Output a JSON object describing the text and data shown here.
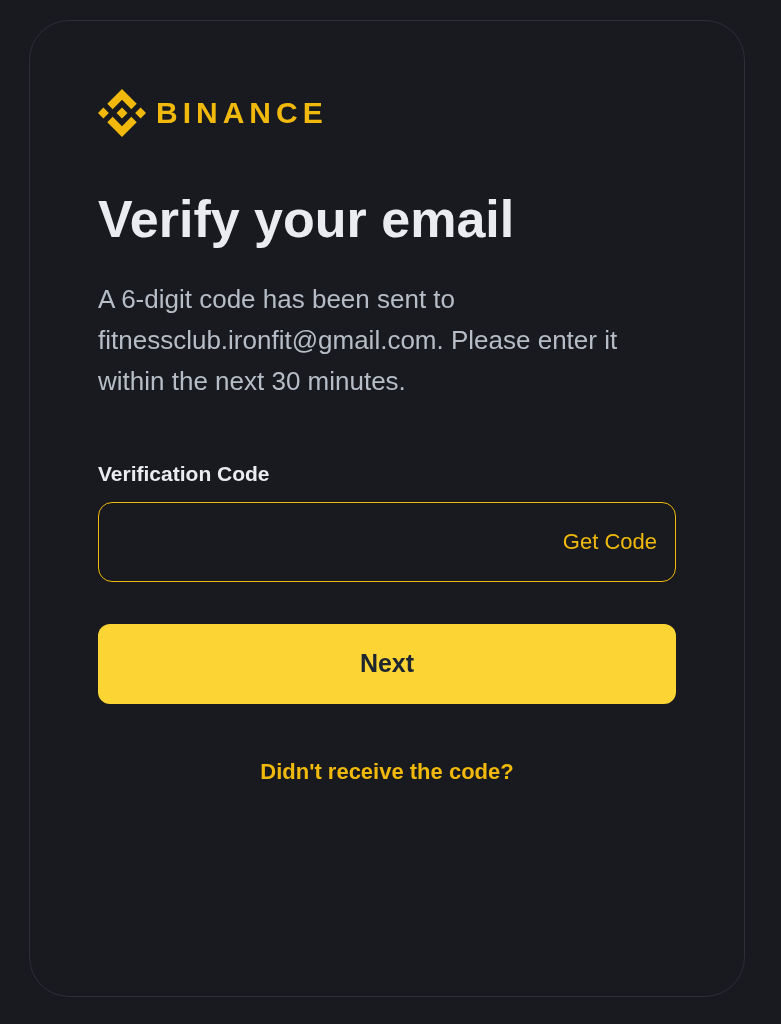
{
  "logo": {
    "wordmark": "BINANCE"
  },
  "title": "Verify your email",
  "description": "A 6-digit code has been sent to fitnessclub.ironfit@gmail.com. Please enter it within the next 30 minutes.",
  "field": {
    "label": "Verification Code",
    "focused": true,
    "action": "Get Code"
  },
  "primary_button": "Next",
  "link": "Didn't receive the code?"
}
